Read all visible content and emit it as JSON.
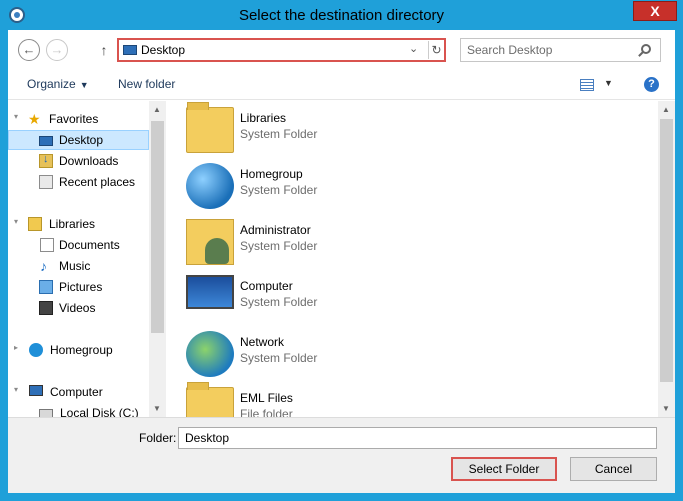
{
  "window": {
    "title": "Select the destination directory",
    "close_glyph": "X"
  },
  "navbar": {
    "back_glyph": "←",
    "forward_glyph": "→",
    "up_glyph": "↑",
    "address_value": "Desktop",
    "address_chevron": "⌄",
    "refresh_glyph": "↻",
    "search_placeholder": "Search Desktop"
  },
  "toolbar": {
    "organize_label": "Organize",
    "organize_caret": "▼",
    "new_folder_label": "New folder",
    "view_caret": "▼",
    "help_glyph": "?"
  },
  "sidebar": {
    "items": [
      {
        "label": "Favorites"
      },
      {
        "label": "Desktop"
      },
      {
        "label": "Downloads"
      },
      {
        "label": "Recent places"
      },
      {
        "label": "Libraries"
      },
      {
        "label": "Documents"
      },
      {
        "label": "Music"
      },
      {
        "label": "Pictures"
      },
      {
        "label": "Videos"
      },
      {
        "label": "Homegroup"
      },
      {
        "label": "Computer"
      },
      {
        "label": "Local Disk (C:)"
      }
    ]
  },
  "content": {
    "items": [
      {
        "name": "Libraries",
        "type": "System Folder"
      },
      {
        "name": "Homegroup",
        "type": "System Folder"
      },
      {
        "name": "Administrator",
        "type": "System Folder"
      },
      {
        "name": "Computer",
        "type": "System Folder"
      },
      {
        "name": "Network",
        "type": "System Folder"
      },
      {
        "name": "EML Files",
        "type": "File folder"
      }
    ]
  },
  "footer": {
    "folder_label": "Folder:",
    "folder_value": "Desktop",
    "select_label": "Select Folder",
    "cancel_label": "Cancel"
  },
  "colors": {
    "frame": "#1fa0d9",
    "close": "#c7302a",
    "highlight": "#d9534f",
    "selection": "#cce8ff"
  },
  "icons": [
    "app-icon",
    "back-icon",
    "forward-icon",
    "up-icon",
    "desktop-icon",
    "refresh-icon",
    "search-icon",
    "view-icon",
    "help-icon",
    "star-icon",
    "downloads-icon",
    "recent-icon",
    "libraries-icon",
    "documents-icon",
    "music-icon",
    "pictures-icon",
    "videos-icon",
    "homegroup-icon",
    "computer-icon",
    "disk-icon",
    "folder-icon",
    "network-icon"
  ]
}
